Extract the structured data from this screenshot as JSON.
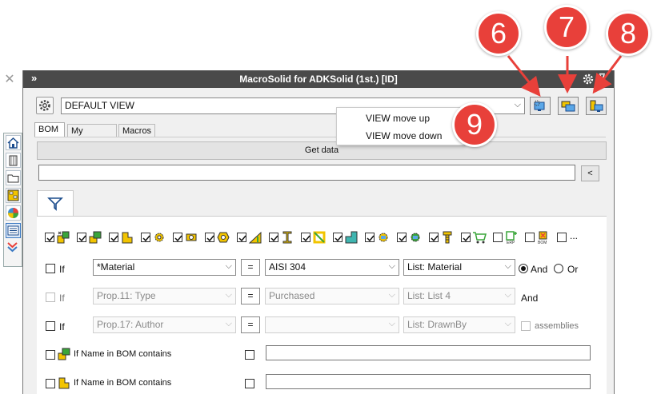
{
  "window": {
    "title": "MacroSolid for ADKSolid (1st.) [ID]",
    "collapse_glyph": "»",
    "pin_glyph": "⊽"
  },
  "close_glyph": "✕",
  "view": {
    "selected": "DEFAULT VIEW",
    "chevron": "⌵"
  },
  "tabs": [
    {
      "label": "BOM",
      "active": true
    },
    {
      "label": "My macros",
      "active": false
    },
    {
      "label": "Macros",
      "active": false
    }
  ],
  "get_data_label": "Get data",
  "collapse_btn_glyph": "<",
  "context_menu": {
    "items": [
      "VIEW move up",
      "VIEW move down"
    ]
  },
  "callouts": [
    "6",
    "7",
    "8",
    "9"
  ],
  "more_types": "...",
  "filters": [
    {
      "if_label": "If",
      "field": "*Material",
      "operator": "=",
      "value": "AISI 304",
      "list": "List: Material",
      "enabled": true,
      "logic": {
        "and": "And",
        "or": "Or",
        "selected": "And"
      }
    },
    {
      "if_label": "If",
      "field": "Prop.11: Type",
      "operator": "=",
      "value": "Purchased",
      "list": "List: List 4",
      "enabled": false,
      "trail": "And"
    },
    {
      "if_label": "If",
      "field": "Prop.17: Author",
      "operator": "=",
      "value": "",
      "list": "List: DrawnBy",
      "enabled": true,
      "trail": "assemblies"
    }
  ],
  "name_filters": [
    {
      "label": "If Name in BOM contains"
    },
    {
      "label": "If Name in BOM contains"
    }
  ],
  "icons": {
    "sidebar": [
      "home-icon",
      "part-icon",
      "folder-icon",
      "assembly-tree-icon",
      "appearance-icon",
      "list-icon",
      "expand-icon"
    ],
    "toolbar": [
      "view-monitor-icon",
      "view-copy-icon",
      "view-save-icon"
    ],
    "types": [
      "assembly-icon",
      "subassembly-icon",
      "part-icon",
      "gear-icon",
      "bolt-icon",
      "nut-icon",
      "weldment-icon",
      "beam-icon",
      "frame-icon",
      "sheetmetal-icon",
      "bracket-icon",
      "mechanism-icon",
      "screw-icon",
      "cart-icon",
      "erp-icon",
      "bom-icon"
    ]
  },
  "colors": {
    "titlebar": "#4a4a4a",
    "callout": "#e8403a",
    "accent_yellow": "#f2c400",
    "accent_green": "#3aa53a"
  }
}
